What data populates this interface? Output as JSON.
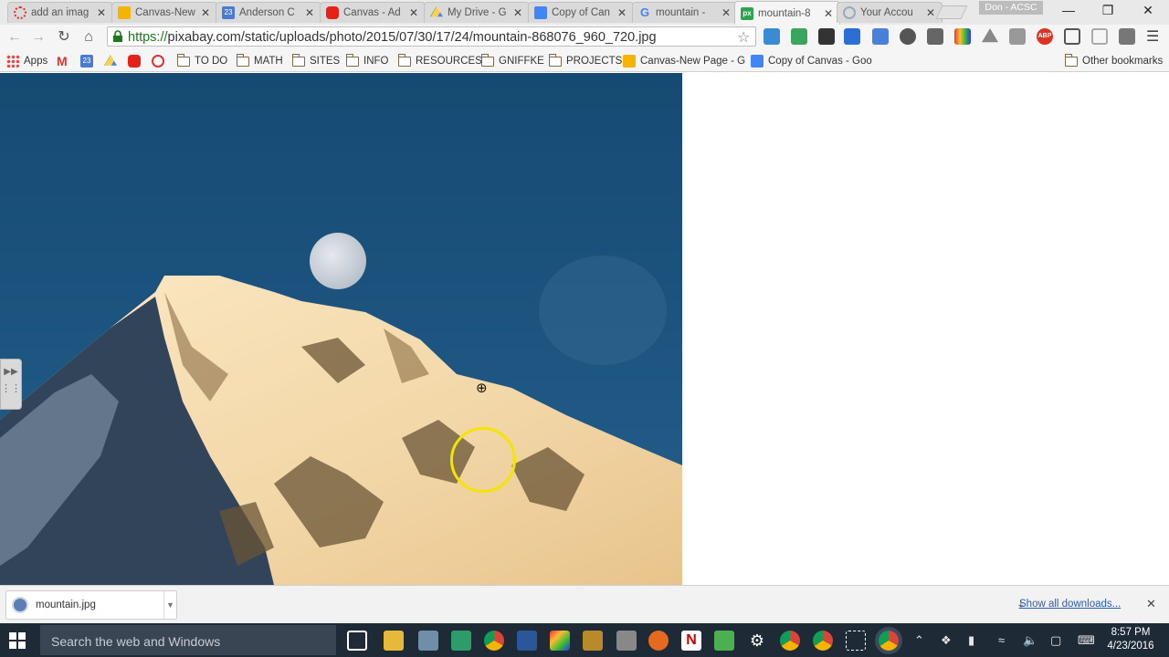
{
  "browser": {
    "profile_name": "Don - ACSC",
    "tabs": [
      {
        "title": "add an imag",
        "favicon": "generic-red-icon"
      },
      {
        "title": "Canvas-New",
        "favicon": "slides-icon"
      },
      {
        "title": "Anderson C",
        "favicon": "calendar-icon"
      },
      {
        "title": "Canvas - Ad",
        "favicon": "youtube-icon"
      },
      {
        "title": "My Drive - G",
        "favicon": "drive-icon"
      },
      {
        "title": "Copy of Can",
        "favicon": "docs-icon"
      },
      {
        "title": "mountain -",
        "favicon": "google-icon"
      },
      {
        "title": "mountain-8",
        "favicon": "pixabay-icon",
        "active": true
      },
      {
        "title": "Your Accou",
        "favicon": "loading-icon"
      }
    ],
    "address": {
      "scheme": "https://",
      "rest": "pixabay.com/static/uploads/photo/2015/07/30/17/24/mountain-868076_960_720.jpg"
    },
    "bookmarks": [
      {
        "label": "Apps",
        "type": "apps"
      },
      {
        "label": "",
        "type": "gmail"
      },
      {
        "label": "",
        "type": "calendar"
      },
      {
        "label": "",
        "type": "drive"
      },
      {
        "label": "",
        "type": "youtube"
      },
      {
        "label": "",
        "type": "generic"
      },
      {
        "label": "TO DO",
        "type": "folder"
      },
      {
        "label": "MATH",
        "type": "folder"
      },
      {
        "label": "SITES",
        "type": "folder"
      },
      {
        "label": "INFO",
        "type": "folder"
      },
      {
        "label": "RESOURCES",
        "type": "folder"
      },
      {
        "label": "GNIFFKE",
        "type": "folder"
      },
      {
        "label": "PROJECTS",
        "type": "folder"
      },
      {
        "label": "Canvas-New Page - G",
        "type": "slides"
      },
      {
        "label": "Copy of Canvas - Goo",
        "type": "docs"
      }
    ],
    "other_bookmarks": "Other bookmarks"
  },
  "downloads": {
    "file_name": "mountain.jpg",
    "show_all": "Show all downloads..."
  },
  "taskbar": {
    "search_placeholder": "Search the web and Windows",
    "time": "8:57 PM",
    "date": "4/23/2016"
  },
  "colors": {
    "sky": "#1b4f78",
    "snow": "#f4dcb1",
    "rock": "#6a5436",
    "cursor_ring": "#f2e600"
  }
}
